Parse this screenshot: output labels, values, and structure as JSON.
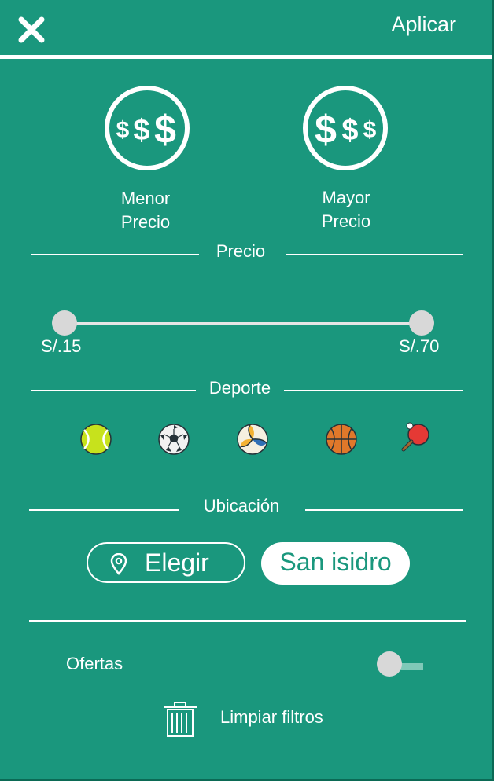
{
  "header": {
    "apply_label": "Aplicar"
  },
  "sort": {
    "low": {
      "symbols": [
        "$",
        "$",
        "$"
      ],
      "label_line1": "Menor",
      "label_line2": "Precio"
    },
    "high": {
      "symbols": [
        "$",
        "$",
        "$"
      ],
      "label_line1": "Mayor",
      "label_line2": "Precio"
    }
  },
  "price": {
    "title": "Precio",
    "min_label": "S/.15",
    "max_label": "S/.70",
    "range_low_fraction": 0,
    "range_high_fraction": 1
  },
  "sport": {
    "title": "Deporte",
    "icons": [
      "tennis-ball-icon",
      "soccer-ball-icon",
      "volleyball-icon",
      "basketball-icon",
      "ping-pong-icon"
    ]
  },
  "location": {
    "title": "Ubicación",
    "choose_label": "Elegir",
    "selected_label": "San isidro"
  },
  "offers": {
    "label": "Ofertas",
    "enabled": false
  },
  "clear": {
    "label": "Limpiar filtros"
  },
  "colors": {
    "background": "#1a977d",
    "foreground": "#ffffff",
    "thumb": "#d8d8d8"
  }
}
